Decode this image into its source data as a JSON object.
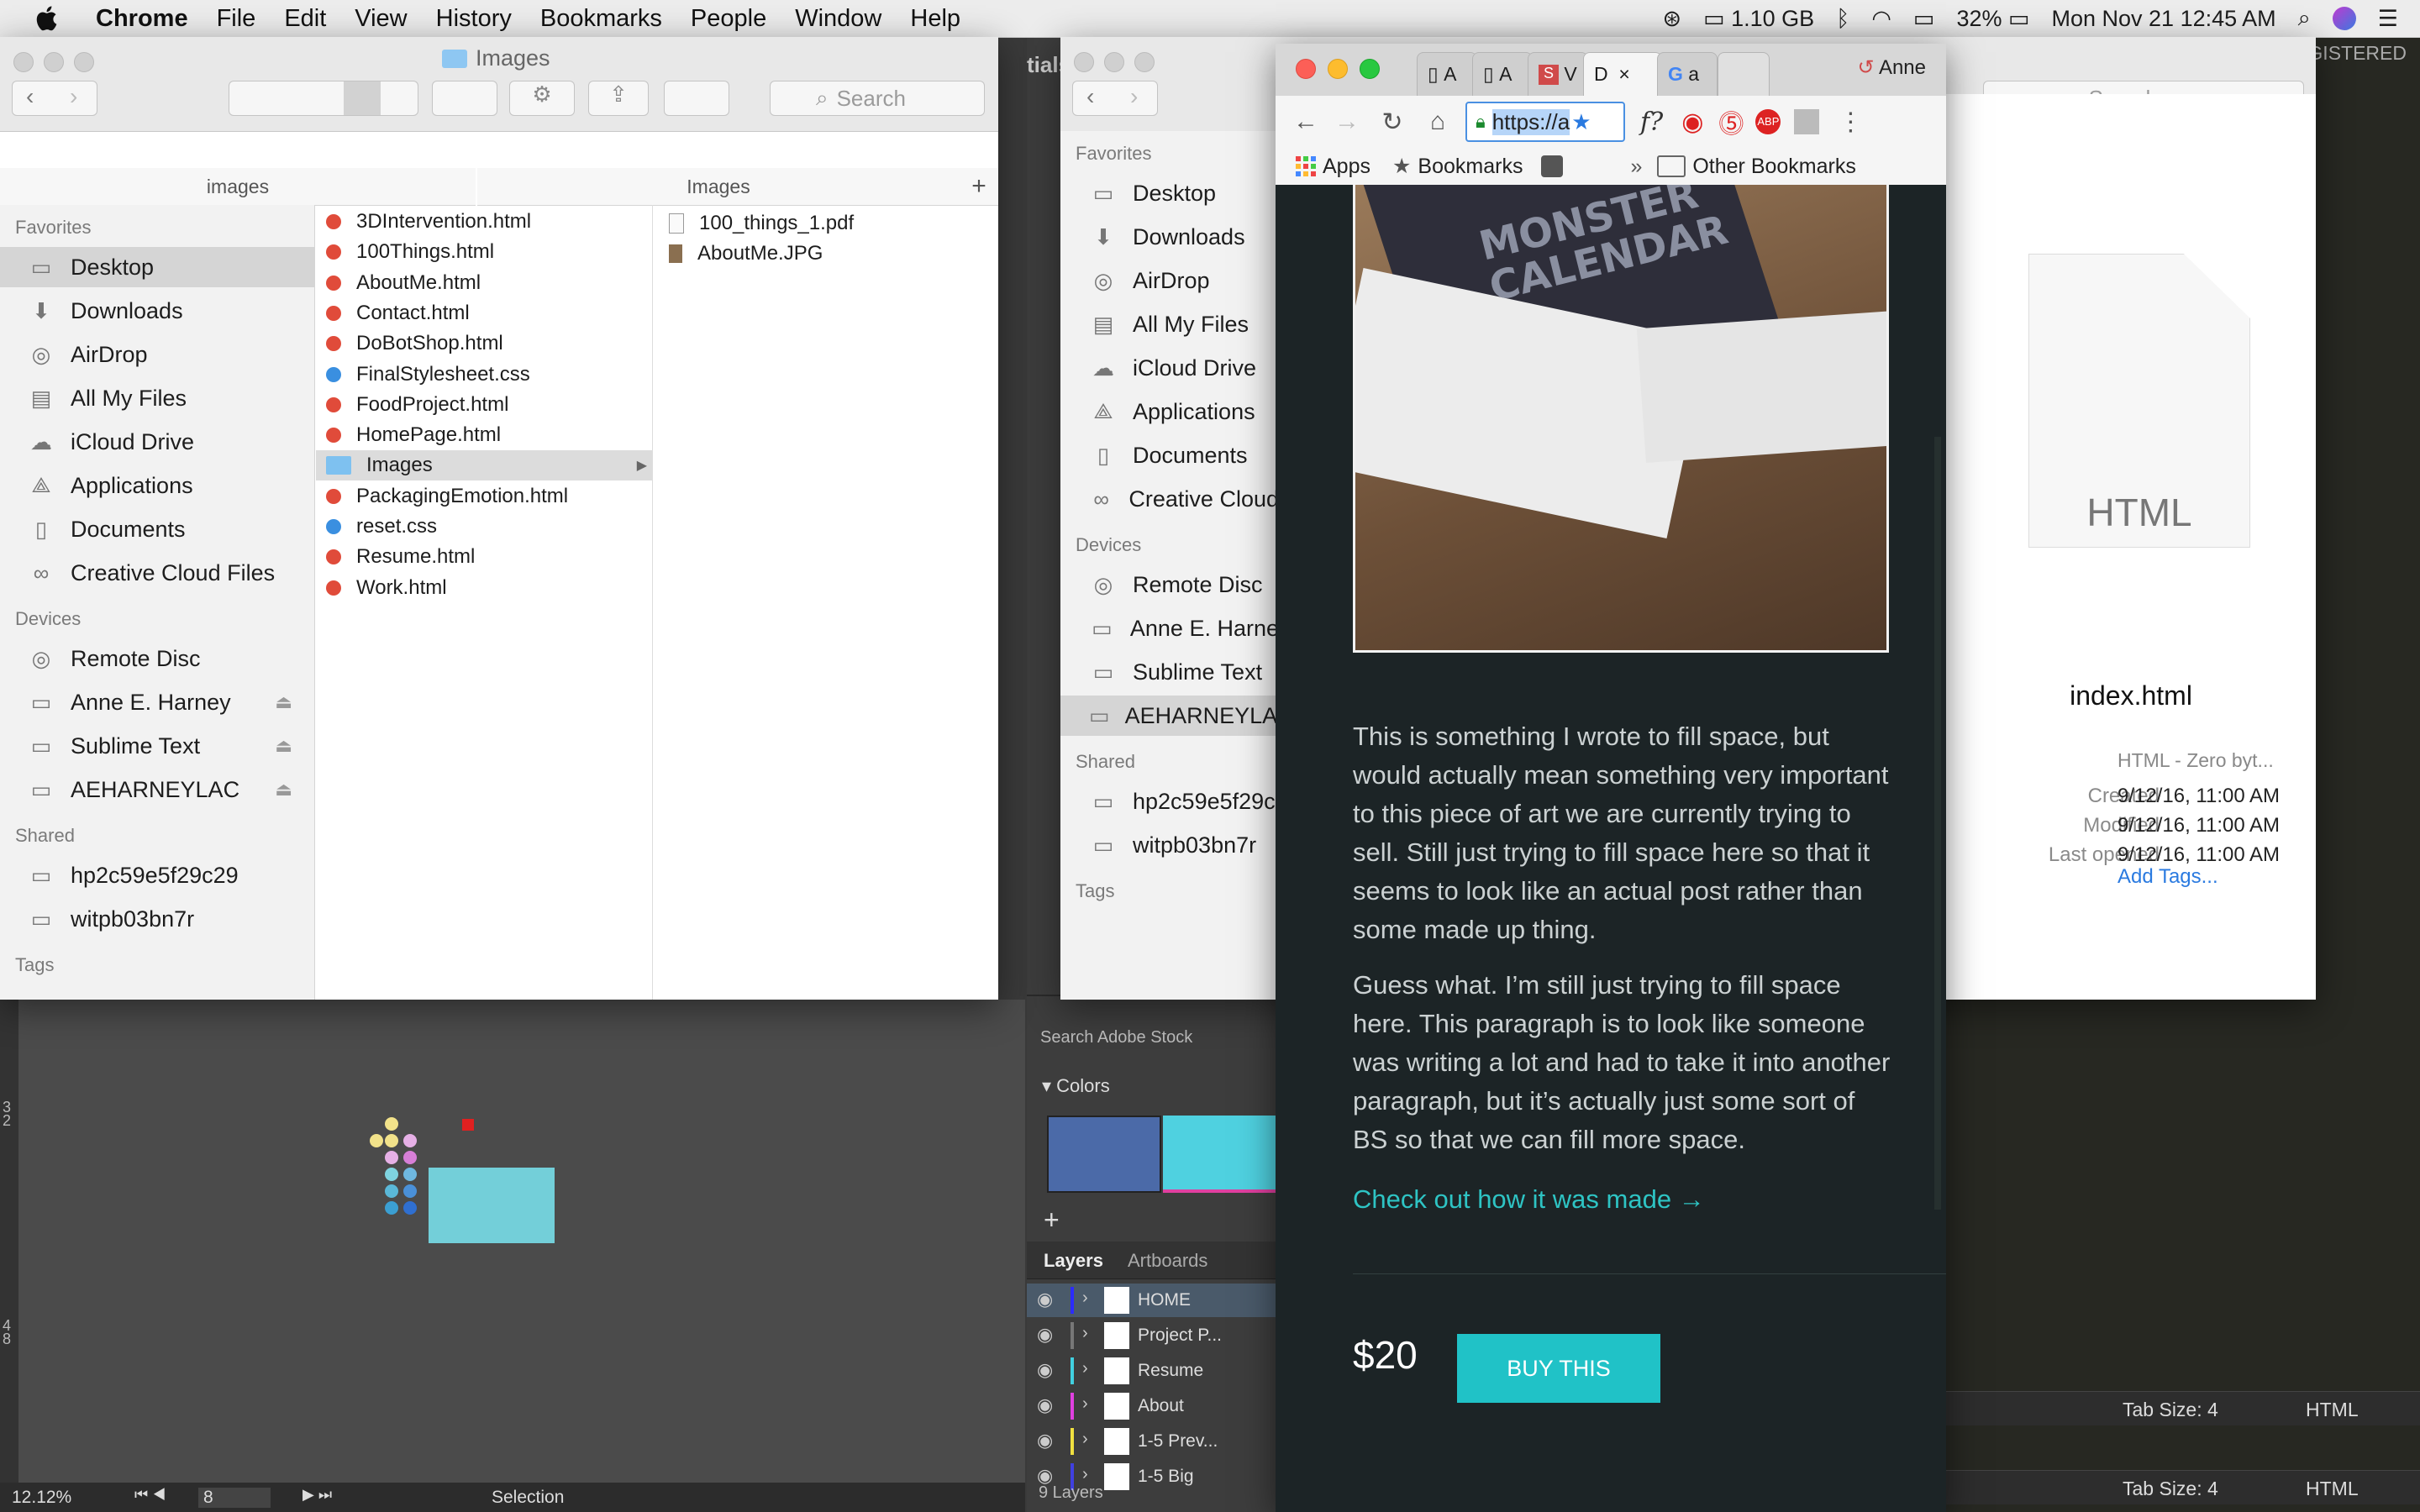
{
  "menubar": {
    "app": "Chrome",
    "items": [
      "File",
      "Edit",
      "View",
      "History",
      "Bookmarks",
      "People",
      "Window",
      "Help"
    ],
    "memory": "1.10 GB",
    "battery": "32%",
    "clock": "Mon Nov 21  12:45 AM"
  },
  "finder1": {
    "title": "Images",
    "search_placeholder": "Search",
    "col_headers": [
      "images",
      "Images"
    ],
    "favorites_label": "Favorites",
    "favorites": [
      {
        "label": "Desktop",
        "icon": "desktop-icon",
        "selected": true
      },
      {
        "label": "Downloads",
        "icon": "downloads-icon"
      },
      {
        "label": "AirDrop",
        "icon": "airdrop-icon"
      },
      {
        "label": "All My Files",
        "icon": "all-files-icon"
      },
      {
        "label": "iCloud Drive",
        "icon": "cloud-icon"
      },
      {
        "label": "Applications",
        "icon": "applications-icon"
      },
      {
        "label": "Documents",
        "icon": "documents-icon"
      },
      {
        "label": "Creative Cloud Files",
        "icon": "creative-cloud-icon"
      }
    ],
    "devices_label": "Devices",
    "devices": [
      {
        "label": "Remote Disc",
        "icon": "disc-icon"
      },
      {
        "label": "Anne E. Harney",
        "icon": "drive-icon",
        "eject": true
      },
      {
        "label": "Sublime Text",
        "icon": "drive-icon",
        "eject": true
      },
      {
        "label": "AEHARNEYLAC",
        "icon": "drive-icon",
        "eject": true
      }
    ],
    "shared_label": "Shared",
    "shared": [
      {
        "label": "hp2c59e5f29c29",
        "icon": "computer-icon"
      },
      {
        "label": "witpb03bn7r",
        "icon": "computer-icon"
      }
    ],
    "tags_label": "Tags",
    "files": [
      {
        "name": "3DIntervention.html",
        "color": "#e04b3a"
      },
      {
        "name": "100Things.html",
        "color": "#e04b3a"
      },
      {
        "name": "AboutMe.html",
        "color": "#e04b3a"
      },
      {
        "name": "Contact.html",
        "color": "#e04b3a"
      },
      {
        "name": "DoBotShop.html",
        "color": "#e04b3a"
      },
      {
        "name": "FinalStylesheet.css",
        "color": "#3a8fe0"
      },
      {
        "name": "FoodProject.html",
        "color": "#e04b3a"
      },
      {
        "name": "HomePage.html",
        "color": "#e04b3a"
      },
      {
        "name": "Images",
        "color": "#7ec1f0",
        "folder": true,
        "selected": true
      },
      {
        "name": "PackagingEmotion.html",
        "color": "#e04b3a"
      },
      {
        "name": "reset.css",
        "color": "#3a8fe0"
      },
      {
        "name": "Resume.html",
        "color": "#e04b3a"
      },
      {
        "name": "Work.html",
        "color": "#e04b3a"
      }
    ],
    "image_files": [
      "100_things_1.pdf",
      "AboutMe.JPG"
    ]
  },
  "finder2": {
    "favorites_label": "Favorites",
    "favorites": [
      "Desktop",
      "Downloads",
      "AirDrop",
      "All My Files",
      "iCloud Drive",
      "Applications",
      "Documents",
      "Creative Cloud"
    ],
    "devices_label": "Devices",
    "devices": [
      "Remote Disc",
      "Anne E. Harne",
      "Sublime Text",
      "AEHARNEYLAC"
    ],
    "shared_label": "Shared",
    "shared": [
      "hp2c59e5f29c",
      "witpb03bn7r"
    ],
    "tags_label": "Tags"
  },
  "chrome": {
    "tabs": [
      "A",
      "A",
      "V",
      "D",
      "a"
    ],
    "profile": "Anne",
    "url": "https://a",
    "bookmarks": [
      "Apps",
      "Bookmarks",
      "Other Bookmarks"
    ],
    "image_text": "MONSTER CALENDAR",
    "paragraph1": "This is something I wrote to fill space, but would actually mean something very important to this piece of art we are currently trying to sell. Still just trying to fill space here so that it seems to look like an actual post rather than some made up thing.",
    "paragraph2": "Guess what. I’m still just trying to fill space here. This paragraph is to look like someone was writing a lot and had to take it into another paragraph, but it’s actually just some sort of BS so that we can fill more space.",
    "link": "Check out how it was made →",
    "price": "$20",
    "buy_label": "BUY THIS"
  },
  "preview": {
    "search_placeholder": "Search",
    "file_type_label": "HTML",
    "file_name": "index.html",
    "kind": "HTML - Zero byt...",
    "meta": [
      {
        "label": "Created",
        "value": "9/12/16, 11:00 AM"
      },
      {
        "label": "Modified",
        "value": "9/12/16, 11:00 AM"
      },
      {
        "label": "Last opened",
        "value": "9/12/16, 11:00 AM"
      }
    ],
    "add_tags": "Add Tags..."
  },
  "illustrator": {
    "panel_title": "tials",
    "colors_label": "Colors",
    "layers_tab": "Layers",
    "artboards_tab": "Artboards",
    "layers": [
      {
        "name": "HOME",
        "color": "#2c2cff"
      },
      {
        "name": "Project P...",
        "color": "#777777"
      },
      {
        "name": "Resume",
        "color": "#41d0e0"
      },
      {
        "name": "About",
        "color": "#e040e0"
      },
      {
        "name": "1-5 Prev...",
        "color": "#f0e040"
      },
      {
        "name": "1-5 Big",
        "color": "#4040e0"
      }
    ],
    "layers_count": "9 Layers",
    "search_stock": "Search Adobe Stock",
    "zoom": "12.12%",
    "artboard_number": "8",
    "status_tool": "Selection",
    "ruler_marks": [
      "3 2",
      "4 8"
    ],
    "swatches": [
      "#4b6aa8",
      "#4fd1e0"
    ]
  },
  "sublime": {
    "registered": "GISTERED",
    "tab_size_label": "Tab Size: 4",
    "syntax_label": "HTML"
  }
}
